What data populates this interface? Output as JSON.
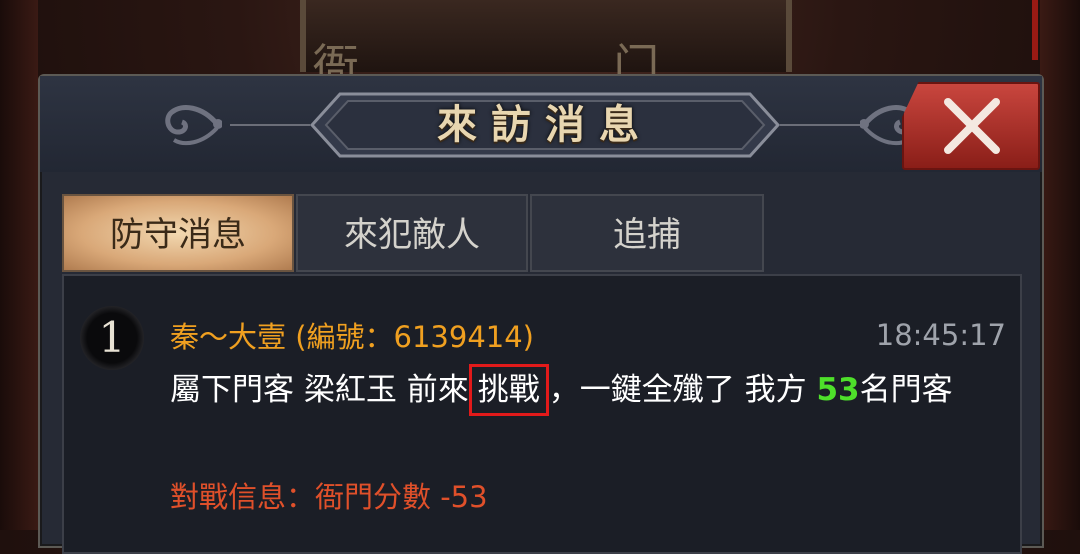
{
  "background": {
    "sign_text": "衙 门"
  },
  "dialog": {
    "title": "來訪消息",
    "close_label": "✕"
  },
  "tabs": [
    {
      "label": "防守消息",
      "active": true
    },
    {
      "label": "來犯敵人",
      "active": false
    },
    {
      "label": "追捕",
      "active": false
    }
  ],
  "messages": [
    {
      "index": "1",
      "sender": "秦〜大壹 (編號：6139414)",
      "time": "18:45:17",
      "text_before": "屬下門客 梁紅玉 前來",
      "highlight": "挑戰",
      "text_mid": "，一鍵全殲了 我方 ",
      "count": "53",
      "text_after": "名門客",
      "info": "對戰信息：衙門分數 -53"
    }
  ],
  "colors": {
    "sender": "#f0a020",
    "count": "#4ee02a",
    "info": "#e0502a",
    "highlight_box": "#e21a1a",
    "close_button": "#c9463e"
  }
}
